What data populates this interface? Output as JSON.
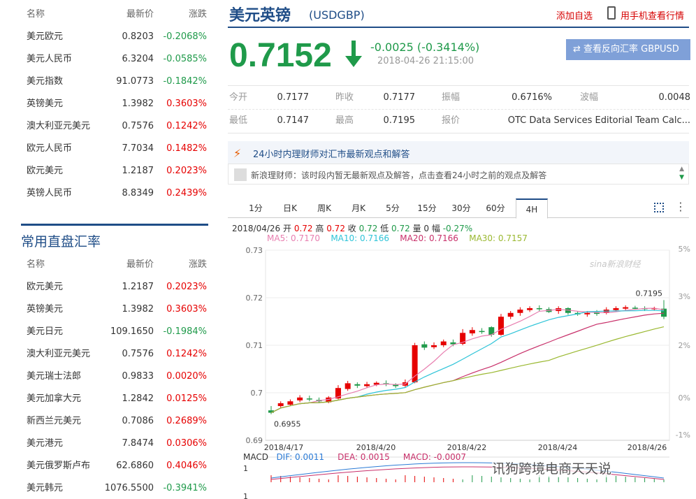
{
  "left": {
    "headers": {
      "name": "名称",
      "price": "最新价",
      "change": "涨跌"
    },
    "top_rows": [
      {
        "name": "美元欧元",
        "price": "0.8203",
        "change": "-0.2068%",
        "dir": "down"
      },
      {
        "name": "美元人民币",
        "price": "6.3204",
        "change": "-0.0585%",
        "dir": "down"
      },
      {
        "name": "美元指数",
        "price": "91.0773",
        "change": "-0.1842%",
        "dir": "down"
      },
      {
        "name": "英镑美元",
        "price": "1.3982",
        "change": "0.3603%",
        "dir": "up"
      },
      {
        "name": "澳大利亚元美元",
        "price": "0.7576",
        "change": "0.1242%",
        "dir": "up"
      },
      {
        "name": "欧元人民币",
        "price": "7.7034",
        "change": "0.1482%",
        "dir": "up"
      },
      {
        "name": "欧元美元",
        "price": "1.2187",
        "change": "0.2023%",
        "dir": "up"
      },
      {
        "name": "英镑人民币",
        "price": "8.8349",
        "change": "0.2439%",
        "dir": "up"
      }
    ],
    "section2_title": "常用直盘汇率",
    "bottom_rows": [
      {
        "name": "欧元美元",
        "price": "1.2187",
        "change": "0.2023%",
        "dir": "up"
      },
      {
        "name": "英镑美元",
        "price": "1.3982",
        "change": "0.3603%",
        "dir": "up"
      },
      {
        "name": "美元日元",
        "price": "109.1650",
        "change": "-0.1984%",
        "dir": "down"
      },
      {
        "name": "澳大利亚元美元",
        "price": "0.7576",
        "change": "0.1242%",
        "dir": "up"
      },
      {
        "name": "美元瑞士法郎",
        "price": "0.9833",
        "change": "0.0020%",
        "dir": "up"
      },
      {
        "name": "美元加拿大元",
        "price": "1.2842",
        "change": "0.0125%",
        "dir": "up"
      },
      {
        "name": "新西兰元美元",
        "price": "0.7086",
        "change": "0.2689%",
        "dir": "up"
      },
      {
        "name": "美元港元",
        "price": "7.8474",
        "change": "0.0306%",
        "dir": "up"
      },
      {
        "name": "美元俄罗斯卢布",
        "price": "62.6860",
        "change": "0.4046%",
        "dir": "up"
      },
      {
        "name": "美元韩元",
        "price": "1076.5500",
        "change": "-0.3941%",
        "dir": "down"
      }
    ]
  },
  "header": {
    "title": "美元英镑",
    "code": "(USDGBP)",
    "add_fav": "添加自选",
    "phone_view": "用手机查看行情"
  },
  "quote": {
    "price": "0.7152",
    "change": "-0.0025 (-0.3414%)",
    "datetime": "2018-04-26 21:15:00",
    "reverse_button": "⇄ 查看反向汇率 GBPUSD"
  },
  "stats": {
    "open_label": "今开",
    "open": "0.7177",
    "prev_close_label": "昨收",
    "prev_close": "0.7177",
    "amplitude_label": "振幅",
    "amplitude": "0.6716%",
    "wave_label": "波幅",
    "wave": "0.0048",
    "low_label": "最低",
    "low": "0.7147",
    "high_label": "最高",
    "high": "0.7195",
    "quote_label": "报价",
    "quote_source": "OTC Data Services Editorial Team Calc..."
  },
  "advisor": {
    "title": "24小时内理财师对汇市最新观点和解答",
    "text": "新浪理财师：该时段内暂无最新观点及解答，点击查看24小时之前的观点及解答"
  },
  "tabs": [
    "1分",
    "日K",
    "周K",
    "月K",
    "5分",
    "15分",
    "30分",
    "60分",
    "4H"
  ],
  "active_tab": "4H",
  "kline_info": {
    "date": "2018/04/26",
    "open_label": "开",
    "open": "0.72",
    "high_label": "高",
    "high": "0.72",
    "close_label": "收",
    "close": "0.72",
    "low_label": "低",
    "low": "0.72",
    "vol_label": "量",
    "vol": "0",
    "amp_label": "幅",
    "amp": "-0.27%"
  },
  "ma_info": {
    "ma5": "MA5: 0.7170",
    "ma10": "MA10: 0.7166",
    "ma20": "MA20: 0.7166",
    "ma30": "MA30: 0.7157"
  },
  "colors": {
    "up": "#e60000",
    "down": "#1f9a4a",
    "ma5": "#e87fb0",
    "ma10": "#2ec4d8",
    "ma20": "#c8306a",
    "ma30": "#9ab830"
  },
  "chart_data": {
    "type": "candlestick",
    "y_ticks": [
      "0.73",
      "0.72",
      "0.71",
      "0.7",
      "0.69"
    ],
    "y_right_ticks": [
      "5%",
      "3%",
      "2%",
      "0%",
      "-1%"
    ],
    "x_ticks": [
      "2018/4/17",
      "2018/4/20",
      "2018/4/22",
      "2018/4/24",
      "2018/4/26"
    ],
    "ylim": [
      0.69,
      0.73
    ],
    "high_label": "0.7195",
    "low_label": "0.6955",
    "watermark": "sina新浪财经",
    "candles": [
      {
        "o": 0.6963,
        "c": 0.6958,
        "h": 0.6972,
        "l": 0.6955
      },
      {
        "o": 0.6972,
        "c": 0.6978,
        "h": 0.6982,
        "l": 0.6968
      },
      {
        "o": 0.6975,
        "c": 0.6982,
        "h": 0.6986,
        "l": 0.6972
      },
      {
        "o": 0.6984,
        "c": 0.699,
        "h": 0.6995,
        "l": 0.698
      },
      {
        "o": 0.6988,
        "c": 0.6986,
        "h": 0.6994,
        "l": 0.6982
      },
      {
        "o": 0.6985,
        "c": 0.6982,
        "h": 0.699,
        "l": 0.698
      },
      {
        "o": 0.698,
        "c": 0.699,
        "h": 0.6993,
        "l": 0.6978
      },
      {
        "o": 0.6988,
        "c": 0.701,
        "h": 0.7016,
        "l": 0.6986
      },
      {
        "o": 0.7008,
        "c": 0.702,
        "h": 0.7025,
        "l": 0.7004
      },
      {
        "o": 0.7018,
        "c": 0.7015,
        "h": 0.7022,
        "l": 0.701
      },
      {
        "o": 0.7014,
        "c": 0.7018,
        "h": 0.7023,
        "l": 0.701
      },
      {
        "o": 0.7017,
        "c": 0.7021,
        "h": 0.7024,
        "l": 0.7014
      },
      {
        "o": 0.702,
        "c": 0.7018,
        "h": 0.7026,
        "l": 0.7014
      },
      {
        "o": 0.7017,
        "c": 0.7014,
        "h": 0.702,
        "l": 0.701
      },
      {
        "o": 0.7015,
        "c": 0.7022,
        "h": 0.7028,
        "l": 0.7012
      },
      {
        "o": 0.7022,
        "c": 0.71,
        "h": 0.7105,
        "l": 0.702
      },
      {
        "o": 0.7102,
        "c": 0.7095,
        "h": 0.7108,
        "l": 0.709
      },
      {
        "o": 0.7096,
        "c": 0.71,
        "h": 0.7106,
        "l": 0.7092
      },
      {
        "o": 0.71,
        "c": 0.7108,
        "h": 0.7112,
        "l": 0.7096
      },
      {
        "o": 0.7106,
        "c": 0.7102,
        "h": 0.7112,
        "l": 0.7098
      },
      {
        "o": 0.7103,
        "c": 0.7126,
        "h": 0.7134,
        "l": 0.71
      },
      {
        "o": 0.7125,
        "c": 0.7132,
        "h": 0.7138,
        "l": 0.712
      },
      {
        "o": 0.713,
        "c": 0.7128,
        "h": 0.7136,
        "l": 0.7124
      },
      {
        "o": 0.7138,
        "c": 0.7122,
        "h": 0.714,
        "l": 0.7118
      },
      {
        "o": 0.7122,
        "c": 0.716,
        "h": 0.7166,
        "l": 0.712
      },
      {
        "o": 0.716,
        "c": 0.7168,
        "h": 0.7172,
        "l": 0.7155
      },
      {
        "o": 0.7168,
        "c": 0.7175,
        "h": 0.718,
        "l": 0.7162
      },
      {
        "o": 0.7174,
        "c": 0.7178,
        "h": 0.7182,
        "l": 0.717
      },
      {
        "o": 0.7178,
        "c": 0.7176,
        "h": 0.7184,
        "l": 0.7172
      },
      {
        "o": 0.7176,
        "c": 0.717,
        "h": 0.718,
        "l": 0.7168
      },
      {
        "o": 0.7172,
        "c": 0.7178,
        "h": 0.7182,
        "l": 0.7166
      },
      {
        "o": 0.7178,
        "c": 0.7168,
        "h": 0.718,
        "l": 0.7164
      },
      {
        "o": 0.7168,
        "c": 0.7165,
        "h": 0.7172,
        "l": 0.7162
      },
      {
        "o": 0.7165,
        "c": 0.7168,
        "h": 0.7172,
        "l": 0.716
      },
      {
        "o": 0.717,
        "c": 0.7166,
        "h": 0.7174,
        "l": 0.7162
      },
      {
        "o": 0.7168,
        "c": 0.7175,
        "h": 0.718,
        "l": 0.7165
      },
      {
        "o": 0.7174,
        "c": 0.7178,
        "h": 0.7182,
        "l": 0.717
      },
      {
        "o": 0.7177,
        "c": 0.718,
        "h": 0.7184,
        "l": 0.7174
      },
      {
        "o": 0.7179,
        "c": 0.7178,
        "h": 0.7183,
        "l": 0.7175
      },
      {
        "o": 0.7178,
        "c": 0.7176,
        "h": 0.7182,
        "l": 0.7172
      },
      {
        "o": 0.7176,
        "c": 0.7178,
        "h": 0.7181,
        "l": 0.7173
      },
      {
        "o": 0.7177,
        "c": 0.716,
        "h": 0.7195,
        "l": 0.7155
      }
    ]
  },
  "macd": {
    "label": "MACD",
    "dif": "DIF: 0.0011",
    "dea": "DEA: 0.0015",
    "macd": "MACD: -0.0007",
    "ticks": [
      "1",
      "1"
    ]
  },
  "watermark_text": "讯狗跨境电商天天说"
}
